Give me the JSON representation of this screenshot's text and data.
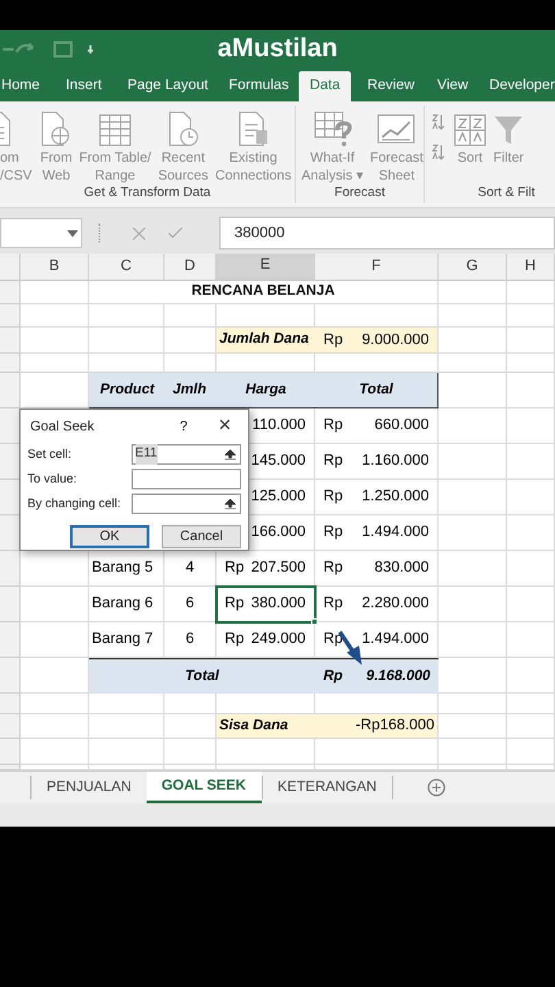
{
  "title_bar": {
    "title": "aMustilan"
  },
  "ribbon_tabs": [
    {
      "label": "Home",
      "selected": false
    },
    {
      "label": "Insert",
      "selected": false
    },
    {
      "label": "Page Layout",
      "selected": false
    },
    {
      "label": "Formulas",
      "selected": false
    },
    {
      "label": "Data",
      "selected": true
    },
    {
      "label": "Review",
      "selected": false
    },
    {
      "label": "View",
      "selected": false
    },
    {
      "label": "Developer",
      "selected": false
    }
  ],
  "ribbon_groups": [
    {
      "label": "Get & Transform Data",
      "buttons": [
        {
          "kind": "text-file",
          "lines": [
            "om",
            "/CSV"
          ]
        },
        {
          "kind": "web-file",
          "lines": [
            "From",
            "Web"
          ]
        },
        {
          "kind": "table",
          "lines": [
            "From Table/",
            "Range"
          ]
        },
        {
          "kind": "clock-file",
          "lines": [
            "Recent",
            "Sources"
          ]
        },
        {
          "kind": "data-file",
          "lines": [
            "Existing",
            "Connections"
          ]
        }
      ]
    },
    {
      "label": "Forecast",
      "buttons": [
        {
          "kind": "what-if",
          "lines": [
            "What-If",
            "Analysis ▾"
          ]
        },
        {
          "kind": "forecast",
          "lines": [
            "Forecast",
            "Sheet"
          ]
        }
      ]
    },
    {
      "label": "Sort & Filt",
      "buttons": [
        {
          "kind": "sort-small"
        },
        {
          "kind": "sort",
          "lines": [
            "Sort"
          ]
        },
        {
          "kind": "filter",
          "lines": [
            "Filter"
          ]
        }
      ]
    }
  ],
  "formula_bar": {
    "value": "380000"
  },
  "columns": [
    {
      "label": "B",
      "selected": false
    },
    {
      "label": "C",
      "selected": false
    },
    {
      "label": "D",
      "selected": false
    },
    {
      "label": "E",
      "selected": true
    },
    {
      "label": "F",
      "selected": false
    },
    {
      "label": "G",
      "selected": false
    },
    {
      "label": "H",
      "selected": false
    }
  ],
  "sheet": {
    "title": "RENCANA BELANJA",
    "fund": {
      "label": "Jumlah Dana",
      "currency": "Rp",
      "amount": "9.000.000"
    },
    "headers": [
      "Product",
      "Jmlh",
      "Harga",
      "Total"
    ],
    "rows": [
      {
        "price": "110.000",
        "currency_total": "Rp",
        "total": "660.000",
        "selected": false
      },
      {
        "price": "145.000",
        "currency_total": "Rp",
        "total": "1.160.000",
        "selected": false
      },
      {
        "price": "125.000",
        "currency_total": "Rp",
        "total": "1.250.000",
        "selected": false
      },
      {
        "price": "166.000",
        "currency_total": "Rp",
        "total": "1.494.000",
        "selected": false
      },
      {
        "product": "Barang 5",
        "qty": "4",
        "currency_price": "Rp",
        "price": "207.500",
        "currency_total": "Rp",
        "total": "830.000",
        "selected": false
      },
      {
        "product": "Barang 6",
        "qty": "6",
        "currency_price": "Rp",
        "price": "380.000",
        "currency_total": "Rp",
        "total": "2.280.000",
        "selected": true
      },
      {
        "product": "Barang 7",
        "qty": "6",
        "currency_price": "Rp",
        "price": "249.000",
        "currency_total": "Rp",
        "total": "1.494.000",
        "selected": false
      }
    ],
    "total": {
      "label": "Total",
      "currency": "Rp",
      "amount": "9.168.000"
    },
    "remaining": {
      "label": "Sisa Dana",
      "amount": "-Rp168.000"
    }
  },
  "dialog": {
    "title": "Goal Seek",
    "help": "?",
    "close": "×",
    "fields": [
      {
        "label": "Set cell:",
        "value": "E11",
        "picker": true
      },
      {
        "label": "To value:",
        "picker": false
      },
      {
        "label": "By changing cell:",
        "picker": true
      }
    ],
    "buttons": [
      {
        "label": "OK",
        "default": true
      },
      {
        "label": "Cancel",
        "default": false
      }
    ]
  },
  "sheet_tabs": [
    {
      "label": "PENJUALAN",
      "selected": false
    },
    {
      "label": "GOAL SEEK",
      "selected": true
    },
    {
      "label": "KETERANGAN",
      "selected": false
    }
  ]
}
